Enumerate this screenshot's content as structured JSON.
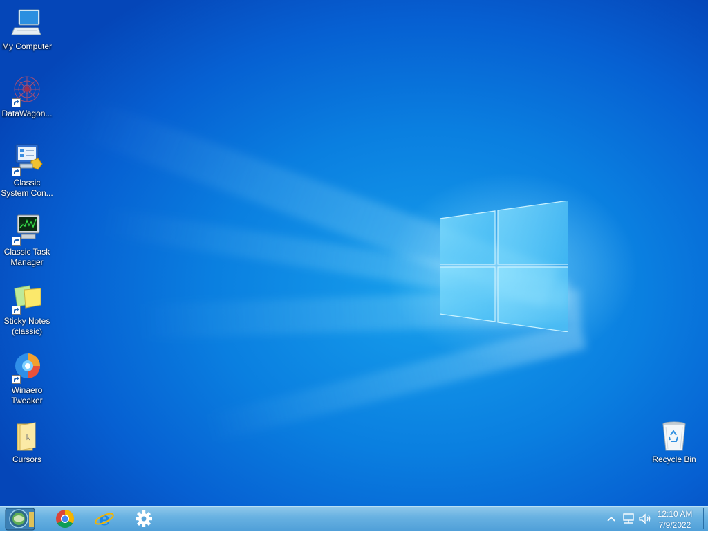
{
  "desktop": {
    "icons": [
      {
        "label": "My Computer",
        "icon": "computer-icon"
      },
      {
        "label": "DataWagon...",
        "icon": "datawagon-icon"
      },
      {
        "label": "Classic System Con...",
        "icon": "control-panel-icon"
      },
      {
        "label": "Classic Task Manager",
        "icon": "task-manager-icon"
      },
      {
        "label": "Sticky Notes (classic)",
        "icon": "sticky-notes-icon"
      },
      {
        "label": "Winaero Tweaker",
        "icon": "winaero-tweaker-icon"
      },
      {
        "label": "Cursors",
        "icon": "folder-icon"
      },
      {
        "label": "Recycle Bin",
        "icon": "recycle-bin-icon"
      }
    ]
  },
  "taskbar": {
    "start": {
      "icon": "start-orb-icon"
    },
    "pinned": [
      {
        "icon": "chrome-icon"
      },
      {
        "icon": "internet-explorer-icon"
      },
      {
        "icon": "settings-gear-icon"
      }
    ],
    "tray": {
      "icons": [
        "chevron-up-icon",
        "network-icon",
        "volume-icon"
      ],
      "time": "12:10 AM",
      "date": "7/9/2022"
    }
  },
  "colors": {
    "wallpaper": "#0a7fe0",
    "taskbar": "#69b2e2"
  }
}
